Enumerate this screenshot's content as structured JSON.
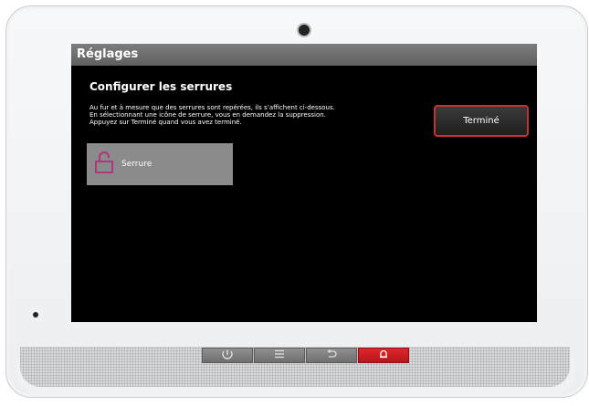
{
  "screen": {
    "title": "Réglages",
    "heading": "Configurer les serrures",
    "description_lines": [
      "Au fur et à mesure que des serrures sont repérées, ils s’affichent ci-dessous.",
      "En sélectionnant une icône de serrure, vous en demandez la suppression.",
      "Appuyez sur Terminé quand vous avez terminé."
    ],
    "done_label": "Terminé",
    "locks": [
      {
        "label": "Serrure",
        "icon": "unlocked-padlock-icon"
      }
    ]
  },
  "hardware_keys": [
    {
      "name": "home-key",
      "icon": "home-icon"
    },
    {
      "name": "menu-key",
      "icon": "menu-icon"
    },
    {
      "name": "back-key",
      "icon": "back-icon"
    },
    {
      "name": "alarm-key",
      "icon": "alarm-icon"
    }
  ],
  "colors": {
    "accent_red": "#c9302c",
    "lock_icon": "#b0357a",
    "tile_gray": "#8b8b8b"
  }
}
